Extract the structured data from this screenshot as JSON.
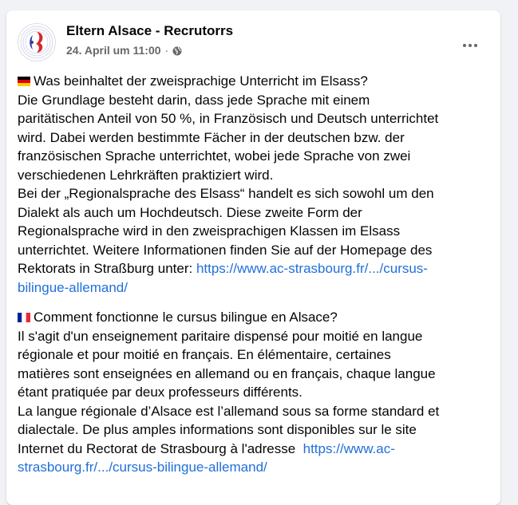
{
  "post": {
    "page_name": "Eltern Alsace - Recrutorrs",
    "date": "24. April um 11:00",
    "separator": "·",
    "privacy_icon": "globe-icon",
    "more_icon": "more-horizontal-icon"
  },
  "german": {
    "flag": "flag-germany-icon",
    "lines": [
      "Was beinhaltet der zweisprachige Unterricht im Elsass?",
      "Die Grundlage besteht darin, dass jede Sprache mit einem",
      "paritätischen Anteil von 50 %, in Französisch und Deutsch unterrichtet",
      "wird. Dabei werden bestimmte Fächer in der deutschen bzw. der",
      "französischen Sprache unterrichtet, wobei jede Sprache von zwei",
      "verschiedenen Lehrkräften praktiziert wird.",
      "Bei der „Regionalsprache des Elsass“ handelt es sich sowohl um den",
      "Dialekt als auch um Hochdeutsch. Diese zweite Form der",
      "Regionalsprache wird in den zweisprachigen Klassen im Elsass",
      "unterrichtet. Weitere Informationen finden Sie auf der Homepage des",
      "Rektorats in Straßburg unter: "
    ],
    "link_part1": "https://www.ac-strasbourg.fr/.../cursus-",
    "link_part2": "bilingue-allemand/"
  },
  "french": {
    "flag": "flag-france-icon",
    "lines": [
      "Comment fonctionne le cursus bilingue en Alsace?",
      "Il s'agit d'un enseignement paritaire dispensé pour moitié en langue",
      "régionale et pour moitié en français.  En élémentaire, certaines",
      "matières sont enseignées en allemand ou en français, chaque langue",
      "étant pratiquée par deux professeurs différents.",
      "La langue régionale d’Alsace est l’allemand sous sa forme standard et",
      "dialectale. De plus amples informations sont disponibles sur le site",
      "Internet du Rectorat de Strasbourg à l'adresse  "
    ],
    "link_part1": "https://www.ac-",
    "link_part2": "strasbourg.fr/.../cursus-bilingue-allemand/"
  },
  "colors": {
    "link": "#216fdb",
    "text": "#050505",
    "secondary": "#65676b"
  }
}
